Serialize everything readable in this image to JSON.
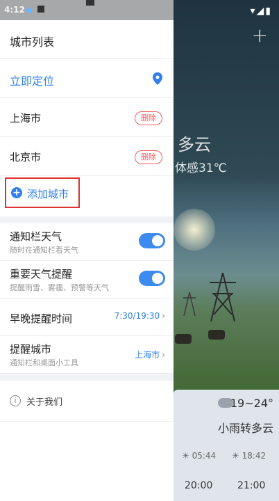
{
  "status_bar": {
    "time": "4:12"
  },
  "background": {
    "condition_partial": "多云",
    "feels_like_partial": "体感31℃",
    "card": {
      "temp_range": "19~24°",
      "description": "小雨转多云",
      "sunrise": "05:44",
      "sunset": "18:42",
      "hour1": "20:00",
      "hour2": "21:00"
    }
  },
  "drawer": {
    "title": "城市列表",
    "locate_label": "立即定位",
    "cities": [
      {
        "name": "上海市",
        "delete_label": "删除"
      },
      {
        "name": "北京市",
        "delete_label": "删除"
      }
    ],
    "add_city_label": "添加城市",
    "settings": {
      "notify_bar": {
        "title": "通知栏天气",
        "subtitle": "随时在通知栏看天气",
        "enabled": true
      },
      "important_alert": {
        "title": "重要天气提醒",
        "subtitle": "提醒雨雪、雾霾、预警等天气",
        "enabled": true
      },
      "reminder_time": {
        "title": "早晚提醒时间",
        "value": "7:30/19:30"
      },
      "reminder_city": {
        "title": "提醒城市",
        "subtitle": "通知栏和桌面小工具",
        "value": "上海市"
      }
    },
    "about_label": "关于我们"
  },
  "colors": {
    "accent": "#2f80ed",
    "delete": "#ef5b5b",
    "toggle_on": "#3d8bf0",
    "highlight_box": "#e03030"
  }
}
